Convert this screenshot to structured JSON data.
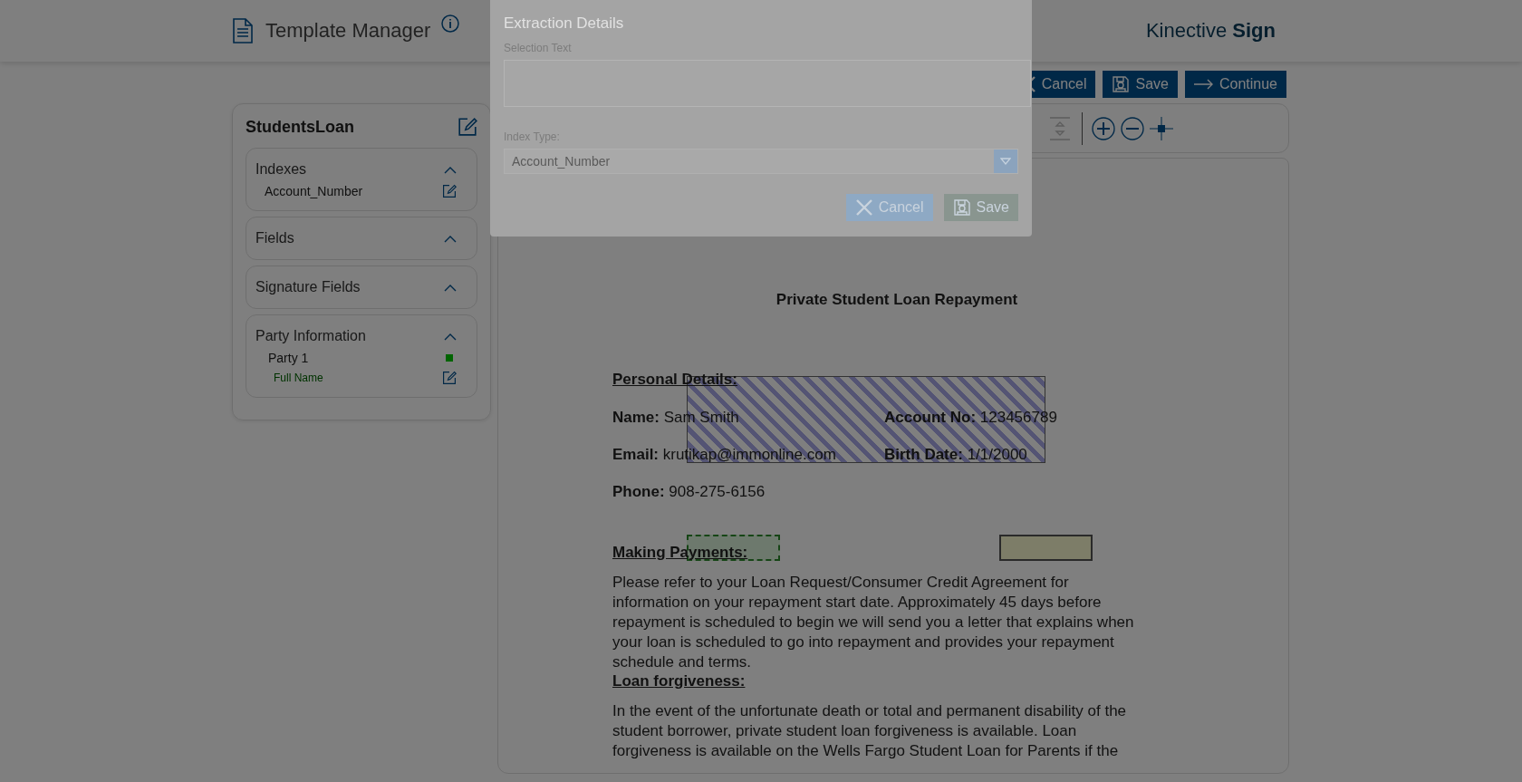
{
  "header": {
    "title": "Template Manager",
    "brand": "Kinective **Sign**"
  },
  "actions": [
    {
      "kind": "cancel",
      "label": "Cancel"
    },
    {
      "kind": "save",
      "label": "Save"
    },
    {
      "kind": "continue",
      "label": "Continue"
    }
  ],
  "template": {
    "name": "StudentsLoan",
    "sections": [
      {
        "title": "Indexes",
        "expanded": true,
        "items": [
          {
            "kind": "index",
            "label": "Account_Number"
          }
        ]
      },
      {
        "title": "Fields",
        "expanded": true
      },
      {
        "title": "Signature Fields",
        "expanded": true
      },
      {
        "title": "Party Information",
        "expanded": true,
        "items": [
          {
            "kind": "party",
            "label": "Party 1",
            "color": "#006400",
            "children": [
              {
                "label": "Full Name"
              }
            ]
          }
        ]
      }
    ]
  },
  "document": {
    "title": "Private Student Loan Repayment",
    "personal_heading": "Personal Details:",
    "rows": [
      [
        "**Name:**  Sam Smith",
        "**Account No:** 123456789"
      ],
      [
        "**Email:** krutikap@immonline.com",
        "**Birth Date:** 1/1/2000"
      ],
      [
        "**Phone:** 908-275-6156"
      ]
    ],
    "payments_heading": "Making Payments:",
    "payments_text": "Please refer to your Loan Request/Consumer Credit Agreement for information on your repayment start date. Approximately 45 days before repayment is scheduled to begin we will send you a letter that explains when your loan is scheduled to go into repayment and provides your repayment schedule and terms.",
    "forgiveness_heading": "Loan forgiveness:",
    "forgiveness_text": "In the event of the unfortunate death or total and permanent disability of the student borrower, private student loan forgiveness is available. Loan forgiveness is available on the Wells Fargo Student Loan for Parents if the"
  },
  "dialog": {
    "title": "Extraction Details",
    "selection_label": "Selection Text",
    "index_type_label": "Index Type:",
    "index_type_value": "Account_Number",
    "buttons": [
      {
        "kind": "cancel",
        "label": "Cancel"
      },
      {
        "kind": "save",
        "label": "Save"
      }
    ]
  }
}
